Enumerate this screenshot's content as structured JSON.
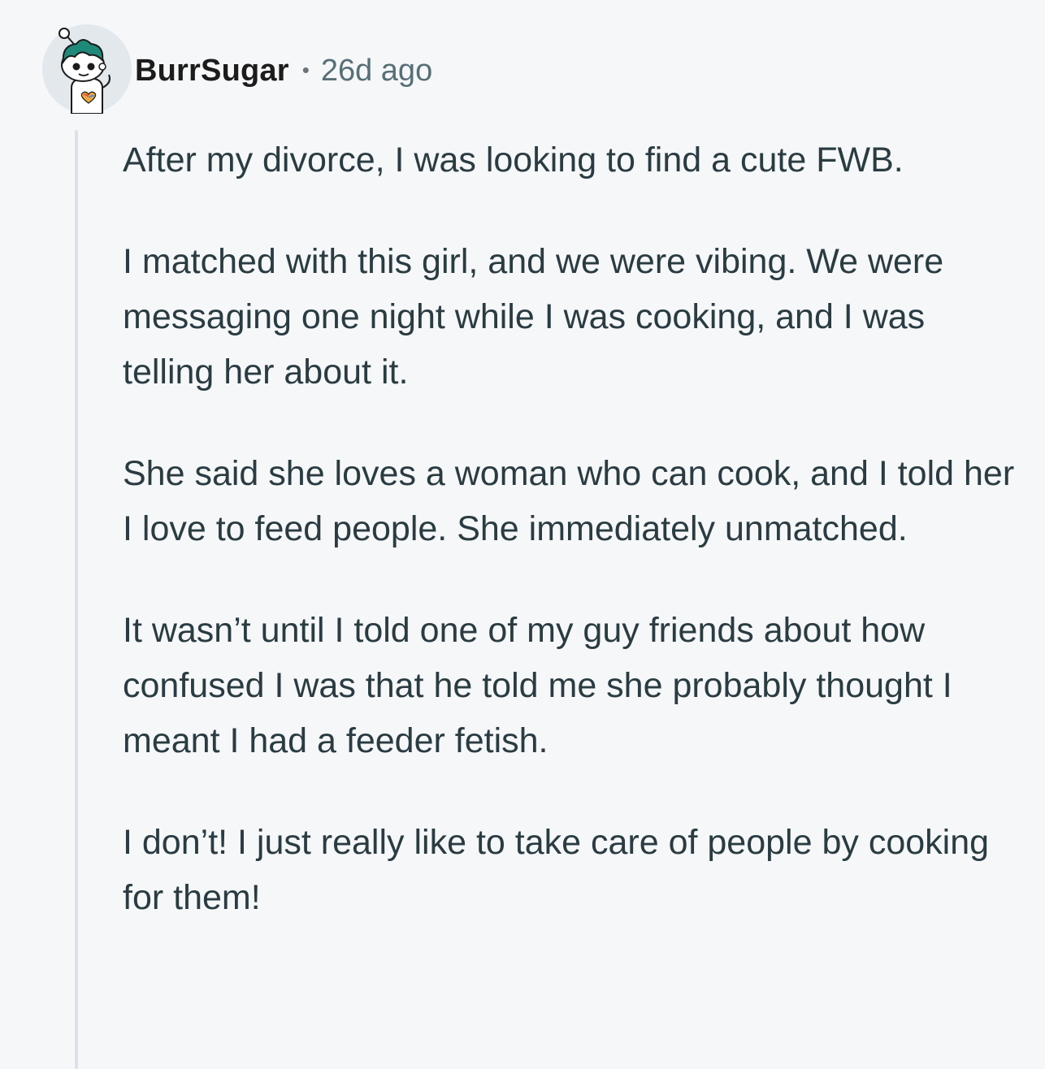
{
  "comment": {
    "username": "BurrSugar",
    "separator": "•",
    "timestamp": "26d ago",
    "paragraphs": [
      "After my divorce, I was looking to find a cute FWB.",
      "I matched with this girl, and we were vibing. We were messaging one night while I was cooking, and I was telling her about it.",
      "She said she loves a woman who can cook, and I told her I love to feed people. She immediately unmatched.",
      "It wasn’t until I told one of my guy friends about how confused I was that he told me she probably thought I meant I had a feeder fetish.",
      "I don’t! I just really like to take care of people by cooking for them!"
    ]
  },
  "icons": {
    "avatar": "snoo-avatar-icon"
  },
  "colors": {
    "background": "#f6f7f9",
    "username": "#1c1c1c",
    "timestamp": "#576f76",
    "body_text": "#2a3c42",
    "thread_line": "#dde2e8",
    "avatar_hair": "#1f8a7a"
  }
}
